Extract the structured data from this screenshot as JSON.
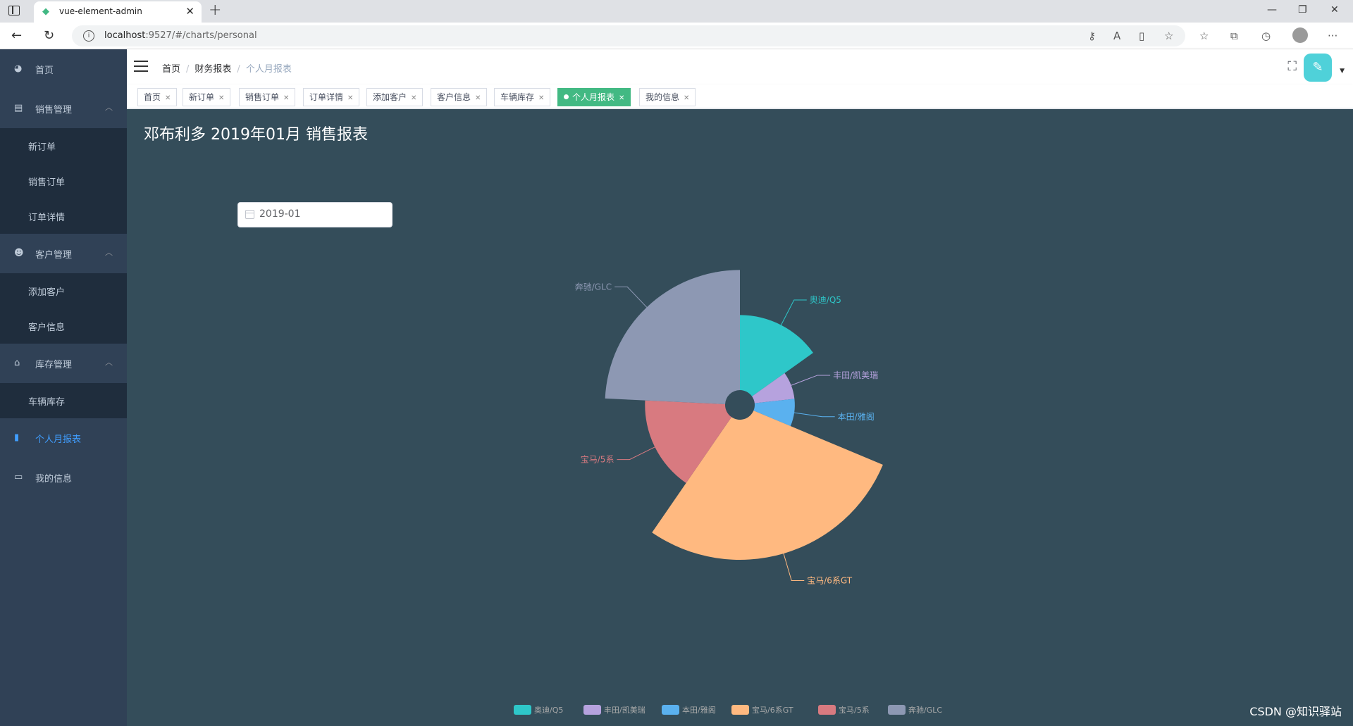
{
  "browser": {
    "tab_title": "vue-element-admin",
    "url_host": "localhost",
    "url_path": ":9527/#/charts/personal"
  },
  "sidebar": {
    "items": [
      {
        "label": "首页",
        "icon": "dashboard-icon"
      },
      {
        "label": "销售管理",
        "icon": "documentation-icon",
        "expanded": true,
        "children": [
          "新订单",
          "销售订单",
          "订单详情"
        ]
      },
      {
        "label": "客户管理",
        "icon": "peoples-icon",
        "expanded": true,
        "children": [
          "添加客户",
          "客户信息"
        ]
      },
      {
        "label": "库存管理",
        "icon": "shopping-icon",
        "expanded": true,
        "children": [
          "车辆库存"
        ]
      },
      {
        "label": "个人月报表",
        "icon": "chart-icon",
        "active": true
      },
      {
        "label": "我的信息",
        "icon": "form-icon"
      }
    ]
  },
  "breadcrumb": {
    "items": [
      "首页",
      "财务报表",
      "个人月报表"
    ]
  },
  "tags": [
    {
      "label": "首页",
      "active": false
    },
    {
      "label": "新订单",
      "active": false
    },
    {
      "label": "销售订单",
      "active": false
    },
    {
      "label": "订单详情",
      "active": false
    },
    {
      "label": "添加客户",
      "active": false
    },
    {
      "label": "客户信息",
      "active": false
    },
    {
      "label": "车辆库存",
      "active": false
    },
    {
      "label": "个人月报表",
      "active": true
    },
    {
      "label": "我的信息",
      "active": false
    }
  ],
  "report": {
    "title": "邓布利多 2019年01月 销售报表",
    "date_value": "2019-01"
  },
  "chart_data": {
    "type": "pie",
    "subtype": "rose",
    "categories": [
      "奥迪/Q5",
      "丰田/凯美瑞",
      "本田/雅阁",
      "宝马/6系GT",
      "宝马/5系",
      "奔驰/GLC"
    ],
    "values": [
      15,
      8,
      8,
      28,
      16,
      24
    ],
    "colors": [
      "#2ec7c9",
      "#b6a2de",
      "#5ab1ef",
      "#ffb980",
      "#d87a80",
      "#8d98b3"
    ],
    "legend_position": "bottom-center"
  },
  "watermark": "CSDN @知识驿站",
  "colors": {
    "sidebar_bg": "#304156",
    "active_tag": "#42b983",
    "active_menu": "#409eff",
    "content_bg": "#344d5a"
  }
}
